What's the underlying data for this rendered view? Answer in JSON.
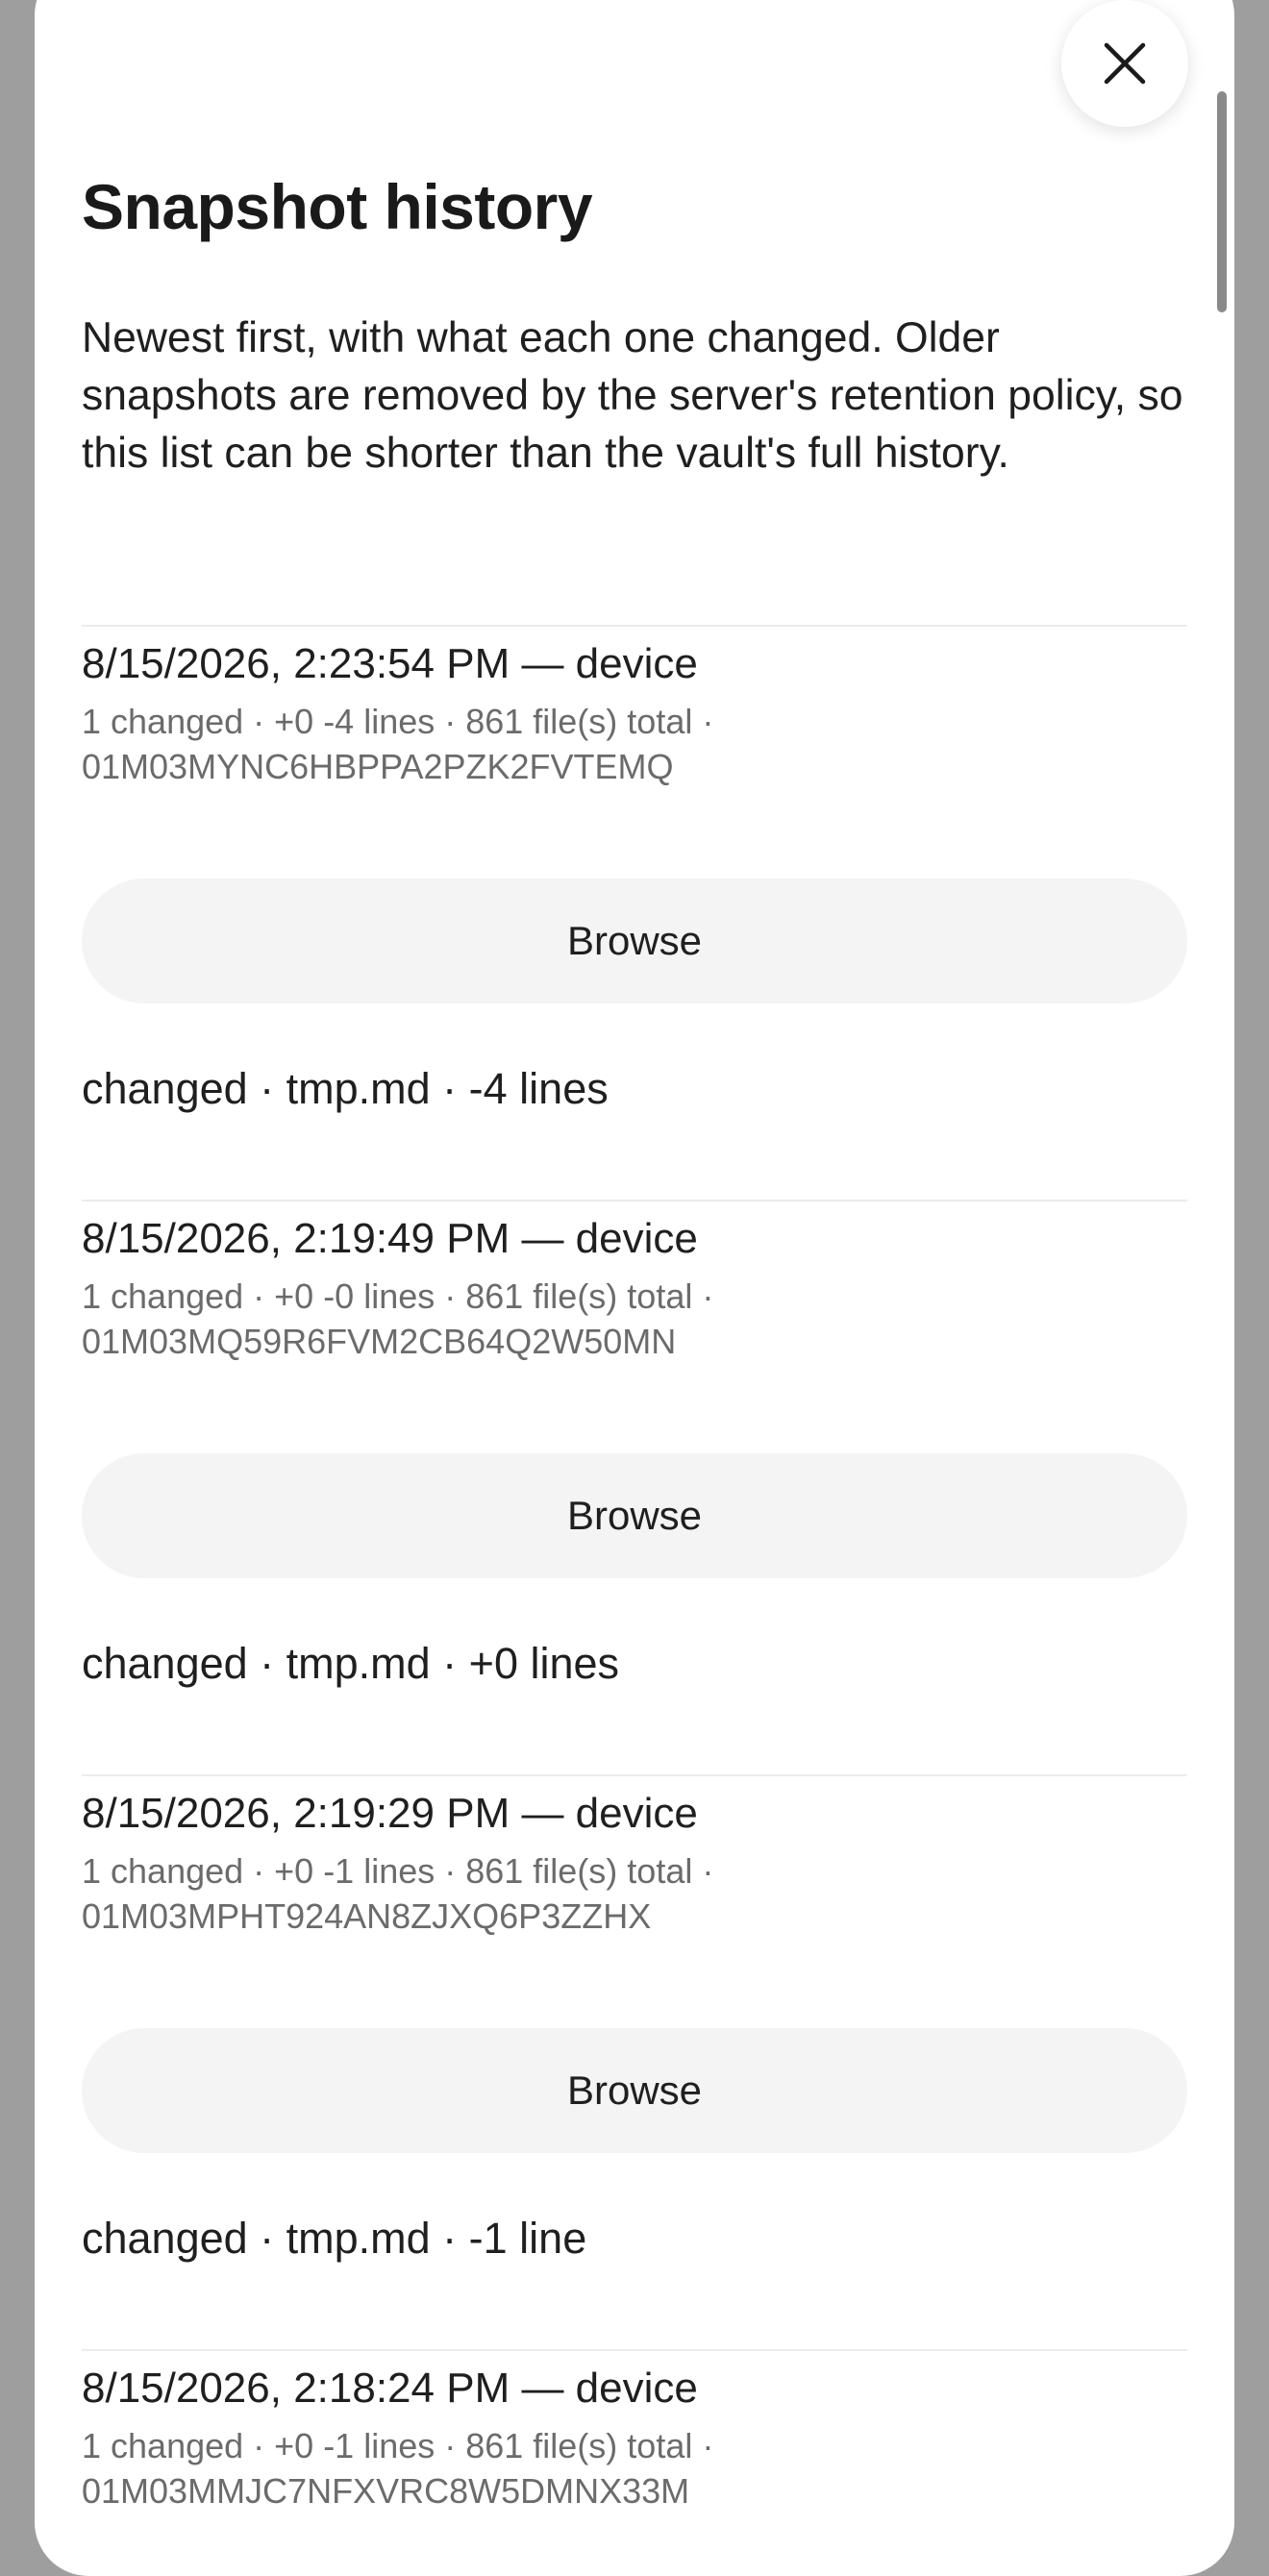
{
  "dialog": {
    "title": "Snapshot history",
    "description": "Newest first, with what each one changed. Older snapshots are removed by the server's retention policy, so this list can be shorter than the vault's full history.",
    "close_icon": "close-icon"
  },
  "snapshots": [
    {
      "title": "8/15/2026, 2:23:54 PM — device",
      "meta": "1 changed · +0 -4 lines · 861 file(s) total · 01M03MYNC6HBPPA2PZK2FVTEMQ",
      "browse_label": "Browse",
      "change": "changed · tmp.md · -4 lines"
    },
    {
      "title": "8/15/2026, 2:19:49 PM — device",
      "meta": "1 changed · +0 -0 lines · 861 file(s) total · 01M03MQ59R6FVM2CB64Q2W50MN",
      "browse_label": "Browse",
      "change": "changed · tmp.md · +0 lines"
    },
    {
      "title": "8/15/2026, 2:19:29 PM — device",
      "meta": "1 changed · +0 -1 lines · 861 file(s) total · 01M03MPHT924AN8ZJXQ6P3ZZHX",
      "browse_label": "Browse",
      "change": "changed · tmp.md · -1 line"
    },
    {
      "title": "8/15/2026, 2:18:24 PM — device",
      "meta": "1 changed · +0 -1 lines · 861 file(s) total · 01M03MMJC7NFXVRC8W5DMNX33M"
    }
  ]
}
